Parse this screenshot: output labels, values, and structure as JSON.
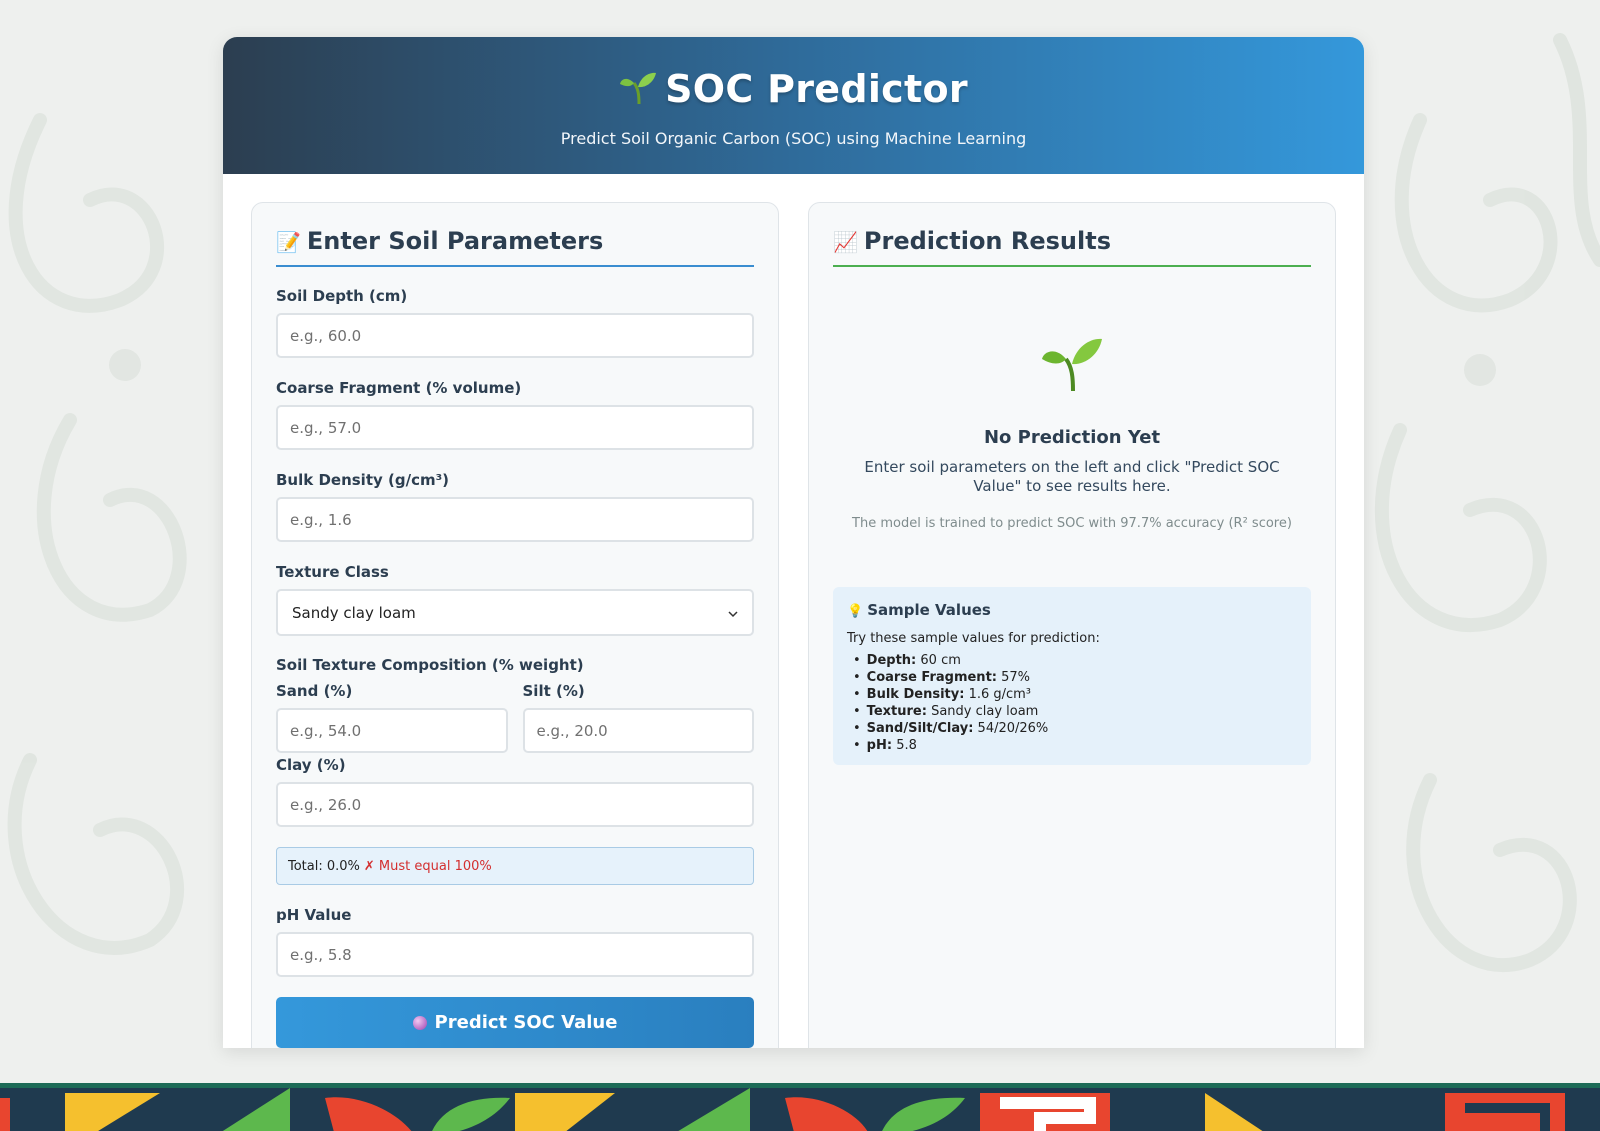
{
  "header": {
    "title": "SOC Predictor",
    "subtitle": "Predict Soil Organic Carbon (SOC) using Machine Learning"
  },
  "form": {
    "heading": "Enter Soil Parameters",
    "depth_label": "Soil Depth (cm)",
    "depth_placeholder": "e.g., 60.0",
    "coarse_label": "Coarse Fragment (% volume)",
    "coarse_placeholder": "e.g., 57.0",
    "bulk_label": "Bulk Density (g/cm³)",
    "bulk_placeholder": "e.g., 1.6",
    "texture_label": "Texture Class",
    "texture_value": "Sandy clay loam",
    "composition_label": "Soil Texture Composition (% weight)",
    "sand_label": "Sand (%)",
    "sand_placeholder": "e.g., 54.0",
    "silt_label": "Silt (%)",
    "silt_placeholder": "e.g., 20.0",
    "clay_label": "Clay (%)",
    "clay_placeholder": "e.g., 26.0",
    "total_text": "Total: 0.0%",
    "total_error": "✗ Must equal 100%",
    "ph_label": "pH Value",
    "ph_placeholder": "e.g., 5.8",
    "submit_label": "Predict SOC Value"
  },
  "results": {
    "heading": "Prediction Results",
    "empty_title": "No Prediction Yet",
    "empty_text": "Enter soil parameters on the left and click \"Predict SOC Value\" to see results here.",
    "note": "The model is trained to predict SOC with 97.7% accuracy (R² score)"
  },
  "samples": {
    "heading": "Sample Values",
    "intro": "Try these sample values for prediction:",
    "items": [
      {
        "key": "Depth:",
        "value": "60 cm"
      },
      {
        "key": "Coarse Fragment:",
        "value": "57%"
      },
      {
        "key": "Bulk Density:",
        "value": "1.6 g/cm³"
      },
      {
        "key": "Texture:",
        "value": "Sandy clay loam"
      },
      {
        "key": "Sand/Silt/Clay:",
        "value": "54/20/26%"
      },
      {
        "key": "pH:",
        "value": "5.8"
      }
    ]
  },
  "colors": {
    "accent_blue": "#3498db",
    "header_dark": "#2c3e50",
    "results_green": "#4caf50",
    "error_red": "#d32f2f"
  }
}
